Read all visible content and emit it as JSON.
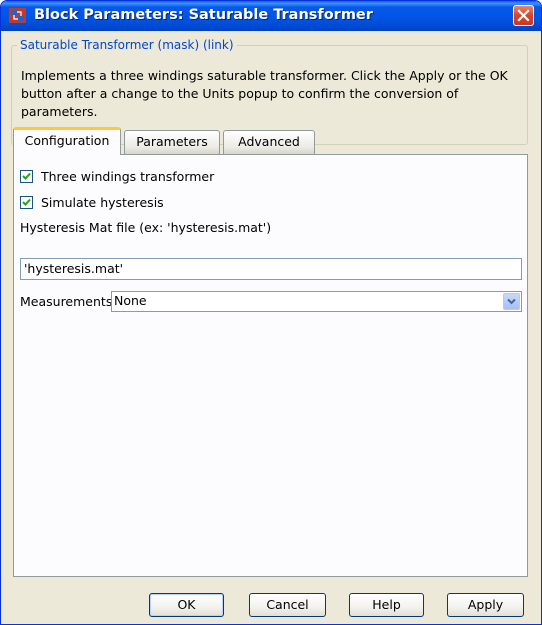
{
  "window": {
    "title": "Block Parameters: Saturable Transformer"
  },
  "group": {
    "legend": "Saturable Transformer (mask) (link)",
    "description_line1": "Implements a three windings saturable transformer. Click the Apply or the OK",
    "description_line2": "button after a change to the Units popup to confirm the conversion of parameters."
  },
  "tabs": [
    {
      "label": "Configuration",
      "active": true
    },
    {
      "label": "Parameters",
      "active": false
    },
    {
      "label": "Advanced",
      "active": false
    }
  ],
  "config": {
    "three_windings": {
      "label": "Three windings transformer",
      "checked": true
    },
    "simulate_hysteresis": {
      "label": "Simulate hysteresis",
      "checked": true
    },
    "hysteresis_file": {
      "label": "Hysteresis Mat file (ex: 'hysteresis.mat')",
      "value": "'hysteresis.mat'"
    },
    "measurements": {
      "label": "Measurements",
      "value": "None"
    }
  },
  "buttons": {
    "ok": "OK",
    "cancel": "Cancel",
    "help": "Help",
    "apply": "Apply"
  },
  "colors": {
    "title_bar": "#0055e5",
    "legend_text": "#0046d5",
    "tab_highlight": "#ffc83c",
    "close_button": "#d5442a"
  }
}
